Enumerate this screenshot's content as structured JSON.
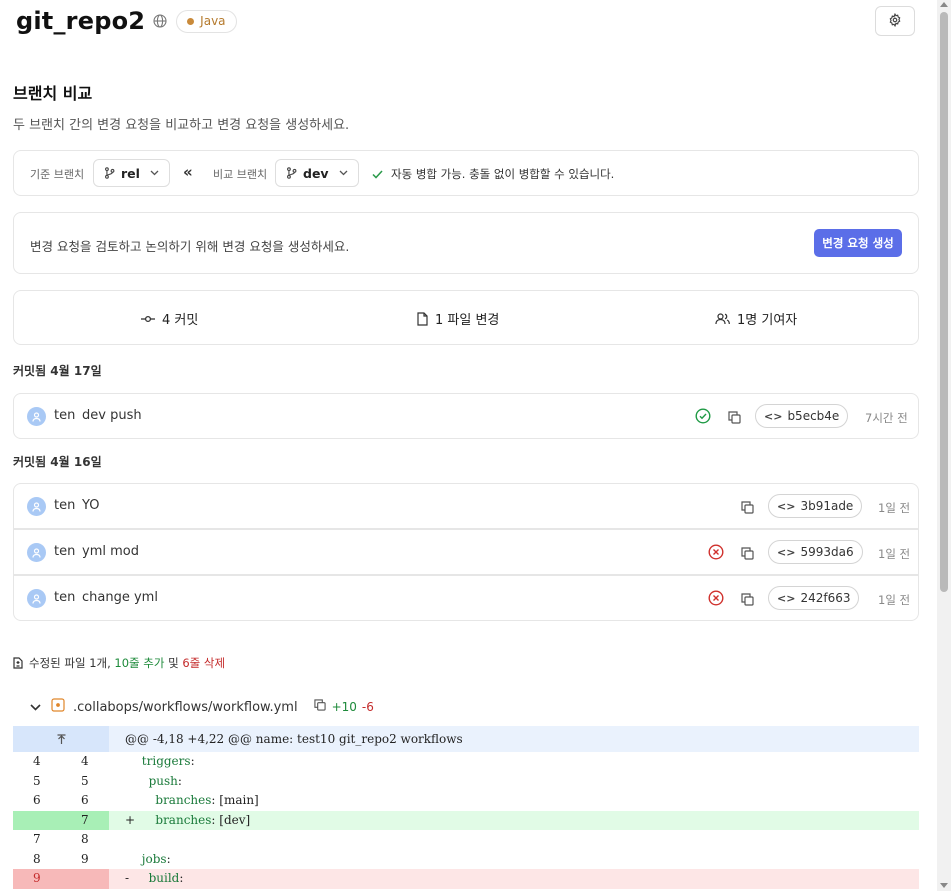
{
  "repo": {
    "name": "git_repo2",
    "language": "Java",
    "colors": {
      "language_dot": "#c98a3a",
      "accent": "#5b6ee8"
    }
  },
  "page": {
    "title": "브랜치 비교",
    "description": "두 브랜치 간의 변경 요청을 비교하고 변경 요청을 생성하세요."
  },
  "compare": {
    "base_label": "기준 브랜치",
    "base_branch": "rel",
    "compare_label": "비교 브랜치",
    "compare_branch": "dev",
    "merge_status": "자동 병합 가능. 충돌 없이 병합할 수 있습니다."
  },
  "pull_request": {
    "prompt": "변경 요청을 검토하고 논의하기 위해 변경 요청을 생성하세요.",
    "button": "변경 요청 생성"
  },
  "stats": {
    "commits": "4 커밋",
    "files": "1 파일 변경",
    "contributors": "1명 기여자"
  },
  "commit_groups": [
    {
      "date": "커밋됨 4월 17일",
      "commits": [
        {
          "author": "ten",
          "message": "dev push",
          "status": "success",
          "sha": "b5ecb4e",
          "time": "7시간 전"
        }
      ]
    },
    {
      "date": "커밋됨 4월 16일",
      "commits": [
        {
          "author": "ten",
          "message": "YO",
          "status": "none",
          "sha": "3b91ade",
          "time": "1일 전"
        },
        {
          "author": "ten",
          "message": "yml mod",
          "status": "failed",
          "sha": "5993da6",
          "time": "1일 전"
        },
        {
          "author": "ten",
          "message": "change yml",
          "status": "failed",
          "sha": "242f663",
          "time": "1일 전"
        }
      ]
    }
  ],
  "files_summary": {
    "prefix": "수정된 파일 1개,",
    "added": "10줄 추가",
    "joiner": "및",
    "removed": "6줄 삭제"
  },
  "file": {
    "path": ".collabops/workflows/workflow.yml",
    "added": "+10",
    "removed": "-6",
    "hunk": "@@ -4,18 +4,22 @@ name: test10 git_repo2 workflows",
    "lines": [
      {
        "old": "4",
        "new": "4",
        "type": "context",
        "sign": "",
        "key": "triggers",
        "rest": ":",
        "indent": "  "
      },
      {
        "old": "5",
        "new": "5",
        "type": "context",
        "sign": "",
        "key": "push",
        "rest": ":",
        "indent": "    "
      },
      {
        "old": "6",
        "new": "6",
        "type": "context",
        "sign": "",
        "key": "branches",
        "rest": ": [main]",
        "indent": "      "
      },
      {
        "old": "",
        "new": "7",
        "type": "added",
        "sign": "+",
        "key": "branches",
        "rest": ": [dev]",
        "indent": "      "
      },
      {
        "old": "7",
        "new": "8",
        "type": "context",
        "sign": "",
        "key": "",
        "rest": "",
        "indent": ""
      },
      {
        "old": "8",
        "new": "9",
        "type": "context",
        "sign": "",
        "key": "jobs",
        "rest": ":",
        "indent": "  "
      },
      {
        "old": "9",
        "new": "",
        "type": "removed",
        "sign": "-",
        "key": "build",
        "rest": ":",
        "indent": "    "
      }
    ]
  }
}
